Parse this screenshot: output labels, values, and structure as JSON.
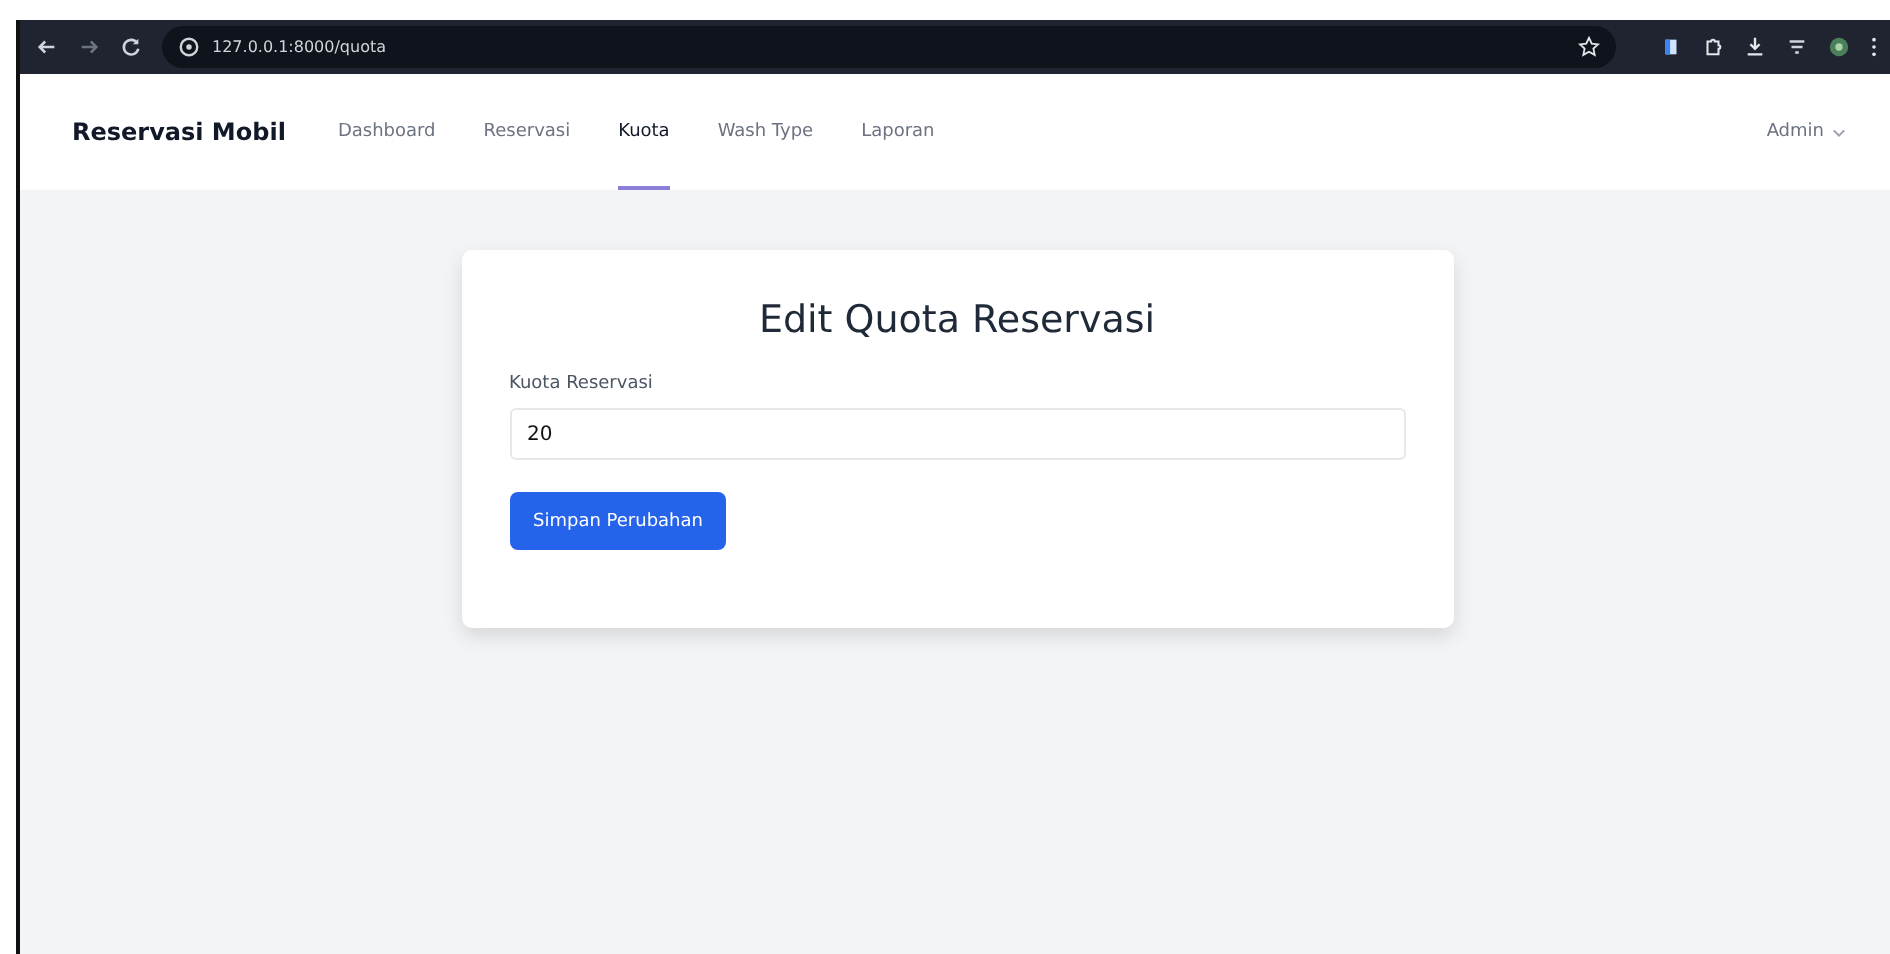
{
  "browser": {
    "url": "127.0.0.1:8000/quota"
  },
  "navbar": {
    "brand": "Reservasi Mobil",
    "links": [
      {
        "label": "Dashboard",
        "selected": false
      },
      {
        "label": "Reservasi",
        "selected": false
      },
      {
        "label": "Kuota",
        "selected": true
      },
      {
        "label": "Wash Type",
        "selected": false
      },
      {
        "label": "Laporan",
        "selected": false
      }
    ],
    "user": "Admin"
  },
  "form": {
    "title": "Edit Quota Reservasi",
    "field_label": "Kuota Reservasi",
    "value": "20",
    "submit": "Simpan Perubahan"
  }
}
